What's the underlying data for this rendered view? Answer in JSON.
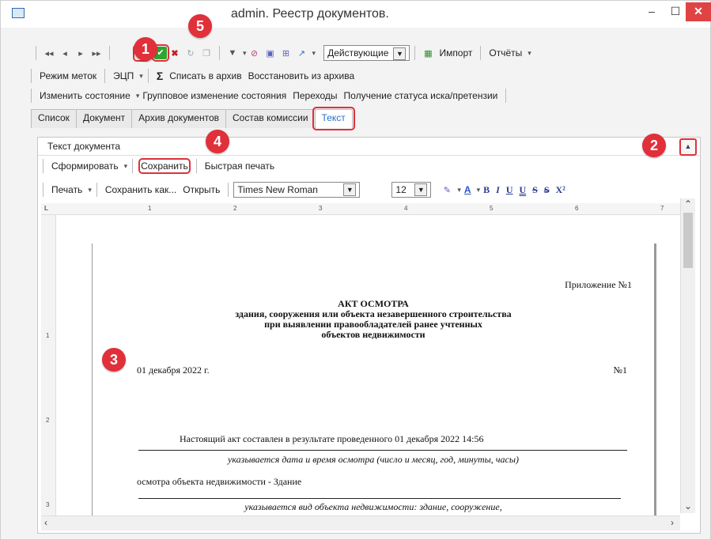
{
  "window": {
    "title": "admin. Реестр документов."
  },
  "toolbar1": {
    "filter_select": "Действующие",
    "import_label": "Импорт",
    "reports_label": "Отчёты"
  },
  "toolbar2": {
    "tag_mode": "Режим меток",
    "ecp": "ЭЦП",
    "sigma": "Σ",
    "archive": "Списать в архив",
    "restore": "Восстановить из архива"
  },
  "toolbar3": {
    "change_state": "Изменить состояние",
    "group_change": "Групповое изменение состояния",
    "transitions": "Переходы",
    "get_status": "Получение статуса иска/претензии"
  },
  "tabs": [
    "Список",
    "Документ",
    "Архив документов",
    "Состав комиссии",
    "Текст"
  ],
  "panel": {
    "title": "Текст документа",
    "form_label": "Сформировать",
    "save_label": "Сохранить",
    "quick_print": "Быстрая печать",
    "print_label": "Печать",
    "save_as": "Сохранить как...",
    "open_label": "Открыть",
    "font_name": "Times New Roman",
    "font_size": "12"
  },
  "format": {
    "bold": "B",
    "italic": "I",
    "underline": "U",
    "double_underline": "U",
    "strike": "S",
    "double_strike": "S",
    "superscript": "X²",
    "font_color": "A"
  },
  "ruler": [
    "1",
    "2",
    "3",
    "4",
    "5",
    "6",
    "7"
  ],
  "vruler": [
    "1",
    "2",
    "3"
  ],
  "document": {
    "appendix": "Приложение №1",
    "heading1": "АКТ ОСМОТРА",
    "heading2": "здания, сооружения или объекта незавершенного строительства",
    "heading3": "при выявлении правообладателей ранее учтенных",
    "heading4": "объектов недвижимости",
    "date": "01 декабря 2022 г.",
    "number": "№1",
    "act_text": "Настоящий акт составлен в результате проведенного   01 декабря  2022 14:56",
    "hint1": "указывается дата и время осмотра (число и месяц, год, минуты, часы)",
    "object_line": "осмотра объекта недвижимости - Здание",
    "hint2": "указывается вид объекта недвижимости: здание, сооружение,"
  },
  "badges": [
    "1",
    "2",
    "3",
    "4",
    "5"
  ],
  "colors": {
    "highlight": "#e0303a",
    "active_tab": "#2a6fc9"
  }
}
